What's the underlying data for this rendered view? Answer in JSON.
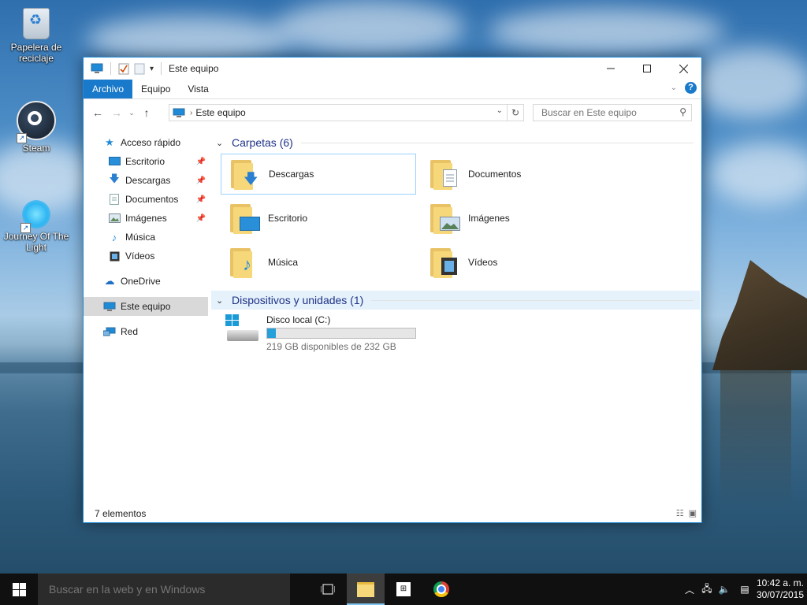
{
  "desktop": {
    "icons": [
      {
        "label": "Papelera de reciclaje",
        "icon": "recycle-bin-icon"
      },
      {
        "label": "Steam",
        "icon": "steam-icon"
      },
      {
        "label": "Journey Of The Light",
        "icon": "journey-icon"
      }
    ]
  },
  "window": {
    "title": "Este equipo",
    "ribbon_tabs": [
      "Archivo",
      "Equipo",
      "Vista"
    ],
    "address": {
      "path": "Este equipo"
    },
    "search": {
      "placeholder": "Buscar en Este equipo"
    }
  },
  "nav_pane": {
    "quick_access": {
      "label": "Acceso rápido",
      "items": [
        {
          "label": "Escritorio",
          "icon": "desktop-folder-icon"
        },
        {
          "label": "Descargas",
          "icon": "downloads-icon"
        },
        {
          "label": "Documentos",
          "icon": "documents-icon"
        },
        {
          "label": "Imágenes",
          "icon": "pictures-icon"
        },
        {
          "label": "Música",
          "icon": "music-icon"
        },
        {
          "label": "Vídeos",
          "icon": "videos-icon"
        }
      ]
    },
    "onedrive": "OneDrive",
    "this_pc": "Este equipo",
    "network": "Red"
  },
  "content": {
    "folders_header": "Carpetas (6)",
    "folders": [
      {
        "label": "Descargas",
        "icon": "downloads-folder-icon"
      },
      {
        "label": "Documentos",
        "icon": "documents-folder-icon"
      },
      {
        "label": "Escritorio",
        "icon": "desktop-folder-icon"
      },
      {
        "label": "Imágenes",
        "icon": "pictures-folder-icon"
      },
      {
        "label": "Música",
        "icon": "music-folder-icon"
      },
      {
        "label": "Vídeos",
        "icon": "videos-folder-icon"
      }
    ],
    "devices_header": "Dispositivos y unidades (1)",
    "drive": {
      "name": "Disco local (C:)",
      "free_text": "219 GB disponibles de 232 GB",
      "used_fraction": 0.056
    }
  },
  "status_bar": {
    "count": "7 elementos"
  },
  "taskbar": {
    "search_placeholder": "Buscar en la web y en Windows",
    "clock_time": "10:42 a. m.",
    "clock_date": "30/07/2015"
  }
}
